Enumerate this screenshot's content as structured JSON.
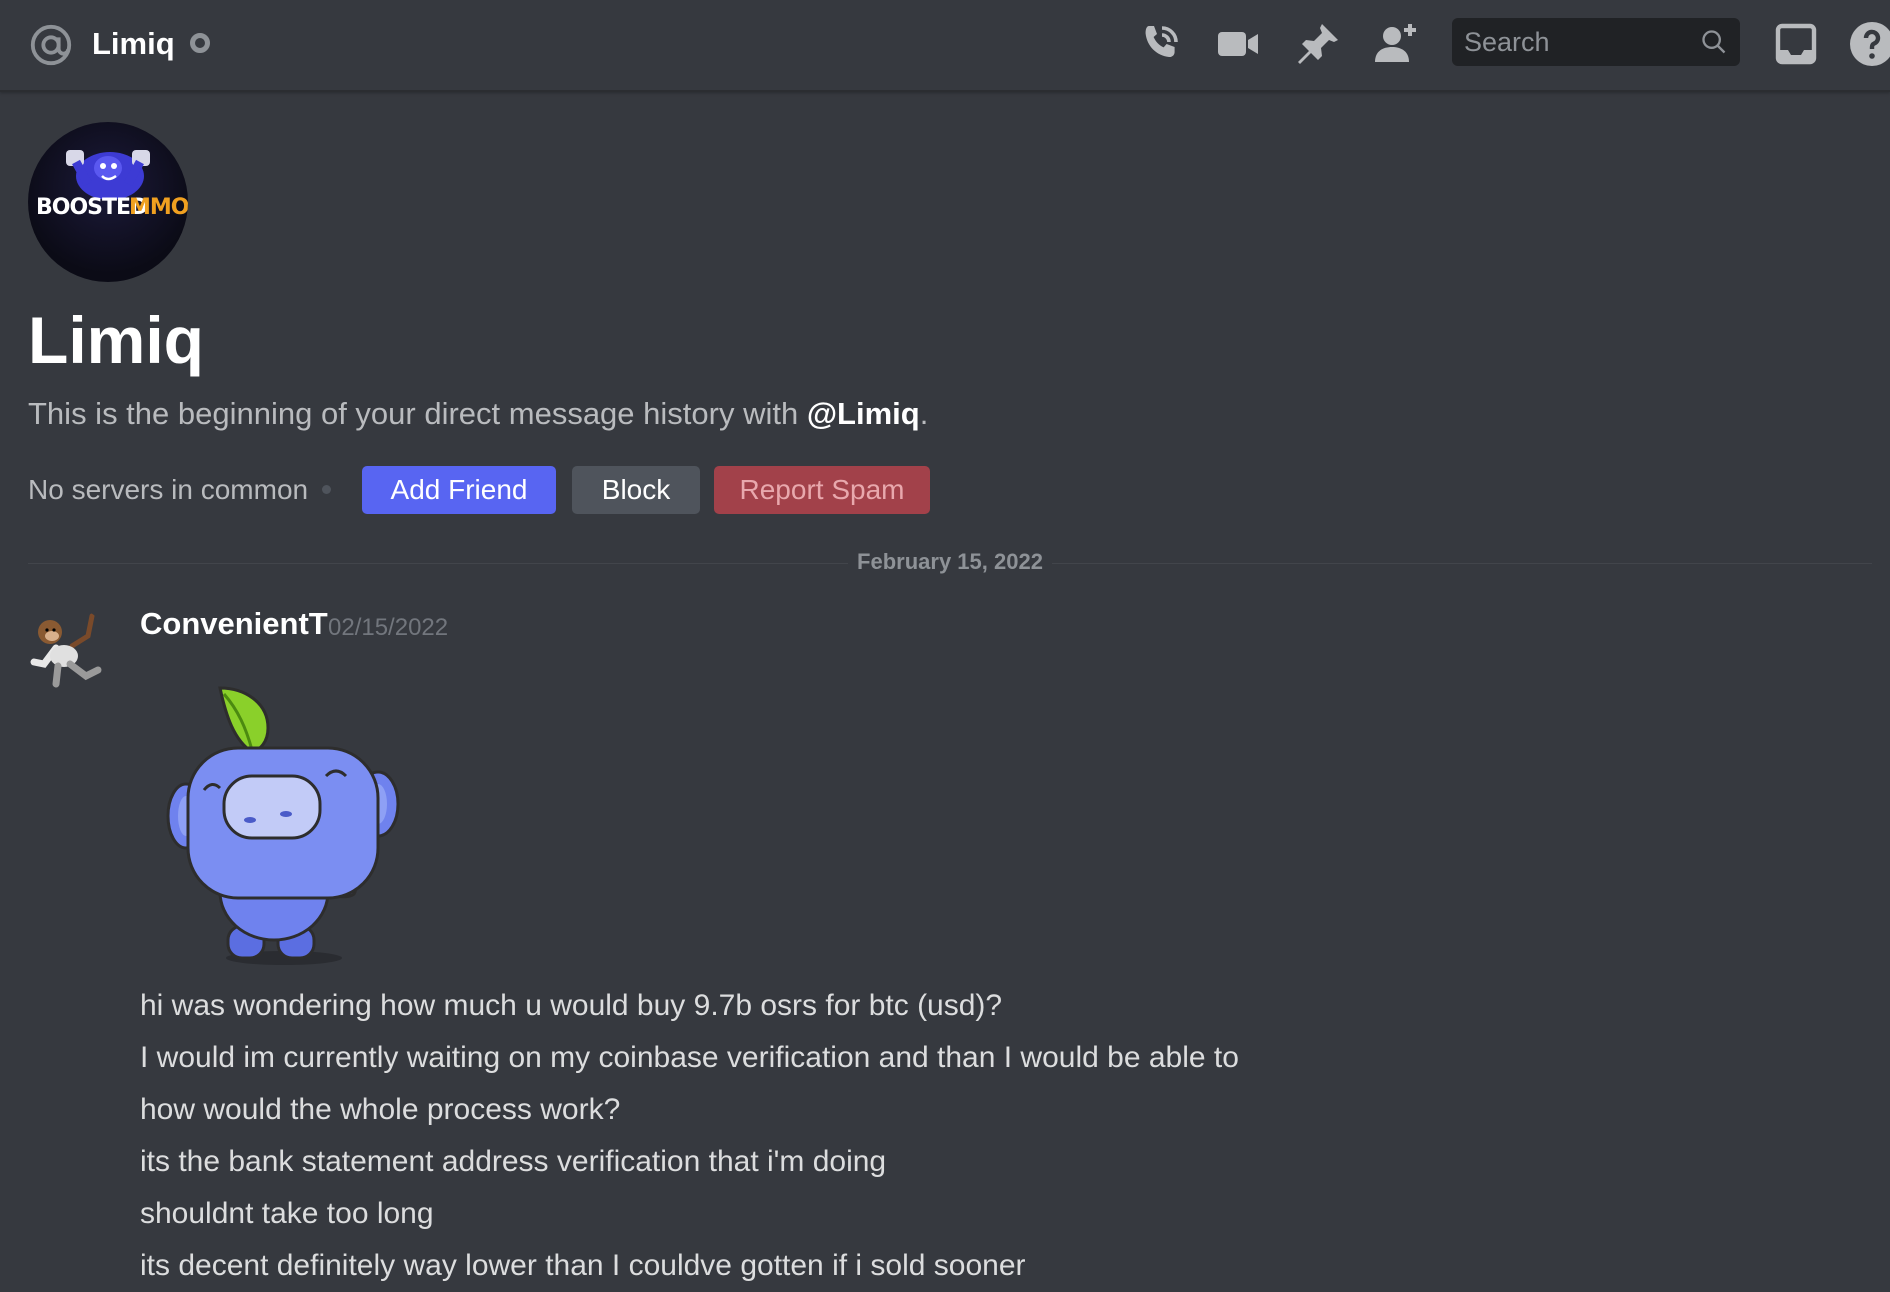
{
  "header": {
    "title": "Limiq",
    "search_placeholder": "Search",
    "icons": [
      "at-icon",
      "call-icon",
      "video-icon",
      "pin-icon",
      "add-member-icon",
      "search-icon",
      "inbox-icon",
      "help-icon"
    ]
  },
  "profile": {
    "avatar_text_1": "BOOSTED",
    "avatar_text_2": "MMO",
    "name": "Limiq",
    "intro_prefix": "This is the beginning of your direct message history with ",
    "intro_handle": "@Limiq",
    "intro_suffix": ".",
    "no_servers": "No servers in common",
    "add_friend": "Add Friend",
    "block": "Block",
    "report_spam": "Report Spam"
  },
  "divider": {
    "date": "February 15, 2022"
  },
  "message": {
    "author": "ConvenientT",
    "timestamp": "02/15/2022",
    "lines": [
      "hi was wondering how much u would buy 9.7b osrs for btc (usd)?",
      "I would im currently waiting on my coinbase verification and than I would be able to",
      "how would the whole process work?",
      "its the bank statement address verification that i'm doing",
      "shouldnt take too long",
      "its decent definitely way lower than I couldve gotten if i sold sooner"
    ]
  },
  "colors": {
    "background": "#36393f",
    "blurple": "#5865f2",
    "danger": "#a2414a",
    "neutral_button": "#4f545c"
  }
}
